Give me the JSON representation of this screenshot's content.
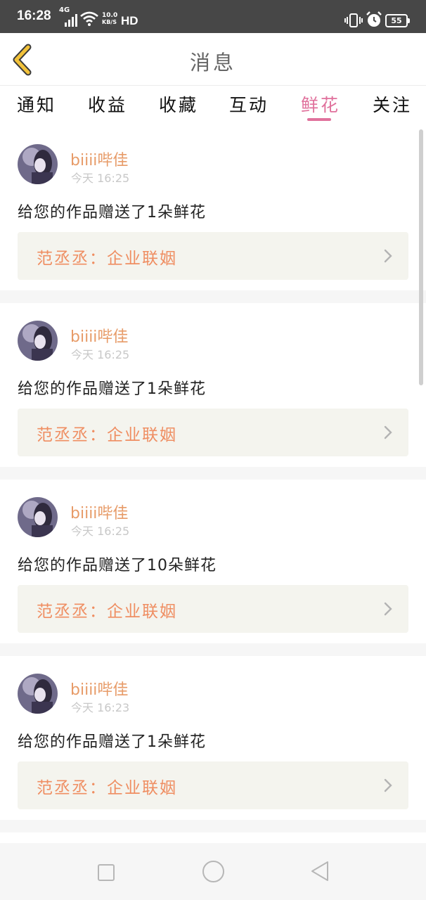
{
  "status_bar": {
    "time": "16:28",
    "network": "4G",
    "speed_value": "10.0",
    "speed_unit": "KB/S",
    "hd": "HD",
    "battery": "55"
  },
  "header": {
    "title": "消息"
  },
  "tabs": [
    {
      "label": "通知"
    },
    {
      "label": "收益"
    },
    {
      "label": "收藏"
    },
    {
      "label": "互动"
    },
    {
      "label": "鲜花",
      "active": true
    },
    {
      "label": "关注"
    }
  ],
  "messages": [
    {
      "user": "biiii哔佳",
      "time": "今天 16:25",
      "text": "给您的作品赠送了1朵鲜花",
      "work": "范丞丞：企业联姻"
    },
    {
      "user": "biiii哔佳",
      "time": "今天 16:25",
      "text": "给您的作品赠送了1朵鲜花",
      "work": "范丞丞：企业联姻"
    },
    {
      "user": "biiii哔佳",
      "time": "今天 16:25",
      "text": "给您的作品赠送了10朵鲜花",
      "work": "范丞丞：企业联姻"
    },
    {
      "user": "biiii哔佳",
      "time": "今天 16:23",
      "text": "给您的作品赠送了1朵鲜花",
      "work": "范丞丞：企业联姻"
    }
  ],
  "colors": {
    "accent": "#e0719c",
    "username": "#e79b68",
    "work_title": "#ef8e62",
    "back_icon": "#f2c23a",
    "status_bar": "#474747"
  },
  "icons": {
    "back": "chevron-left-icon",
    "work_arrow": "chevron-right-icon",
    "nav_recent": "square-icon",
    "nav_home": "circle-icon",
    "nav_back": "triangle-left-icon"
  }
}
